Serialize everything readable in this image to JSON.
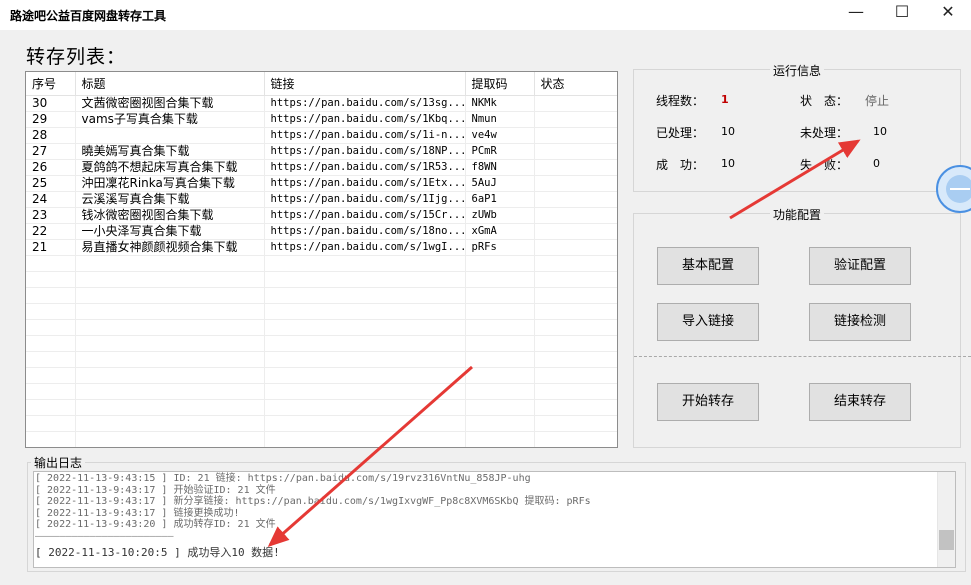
{
  "window": {
    "title": "路途吧公益百度网盘转存工具",
    "controls": {
      "minimize": "—",
      "maximize": "☐",
      "close": "✕"
    }
  },
  "list": {
    "title": "转存列表：",
    "columns": [
      "序号",
      "标题",
      "链接",
      "提取码",
      "状态"
    ],
    "rows": [
      {
        "id": "30",
        "title": "文茜微密圈视图合集下载",
        "link": "https://pan.baidu.com/s/13sg...",
        "code": "NKMk",
        "status": ""
      },
      {
        "id": "29",
        "title": "vams子写真合集下载",
        "link": "https://pan.baidu.com/s/1Kbq...",
        "code": "Nmun",
        "status": ""
      },
      {
        "id": "28",
        "title": "",
        "link": "https://pan.baidu.com/s/1i-n...",
        "code": "ve4w",
        "status": ""
      },
      {
        "id": "27",
        "title": "曉美嫣写真合集下载",
        "link": "https://pan.baidu.com/s/18NP...",
        "code": "PCmR",
        "status": ""
      },
      {
        "id": "26",
        "title": "夏鸽鸽不想起床写真合集下载",
        "link": "https://pan.baidu.com/s/1R53...",
        "code": "f8WN",
        "status": ""
      },
      {
        "id": "25",
        "title": "沖田凜花Rinka写真合集下载",
        "link": "https://pan.baidu.com/s/1Etx...",
        "code": "5AuJ",
        "status": ""
      },
      {
        "id": "24",
        "title": "云溪溪写真合集下载",
        "link": "https://pan.baidu.com/s/1Ijg...",
        "code": "6aP1",
        "status": ""
      },
      {
        "id": "23",
        "title": "钱冰微密圈视图合集下载",
        "link": "https://pan.baidu.com/s/15Cr...",
        "code": "zUWb",
        "status": ""
      },
      {
        "id": "22",
        "title": "一小央泽写真合集下载",
        "link": "https://pan.baidu.com/s/18no...",
        "code": "xGmA",
        "status": ""
      },
      {
        "id": "21",
        "title": "易直播女神颜颜视频合集下载",
        "link": "https://pan.baidu.com/s/1wgI...",
        "code": "pRFs",
        "status": ""
      }
    ]
  },
  "run_info": {
    "legend": "运行信息",
    "threads_label": "线程数：",
    "threads_value": "1",
    "state_label": "状　态：",
    "state_value": "停止",
    "processed_label": "已处理：",
    "processed_value": "10",
    "unprocessed_label": "未处理：",
    "unprocessed_value": "10",
    "success_label": "成　功：",
    "success_value": "10",
    "fail_label": "失　败：",
    "fail_value": "0"
  },
  "config": {
    "legend": "功能配置",
    "basic_config": "基本配置",
    "verify_config": "验证配置",
    "import_links": "导入链接",
    "check_links": "链接检测",
    "start_transfer": "开始转存",
    "end_transfer": "结束转存"
  },
  "log": {
    "legend": "输出日志",
    "lines": [
      "[ 2022-11-13-9:43:15 ] ID: 21 链接: https://pan.baidu.com/s/19rvz316VntNu_858JP-uhg",
      "[ 2022-11-13-9:43:17 ] 开始验证ID: 21 文件",
      "[ 2022-11-13-9:43:17 ] 新分享链接: https://pan.baidu.com/s/1wgIxvgWF_Pp8c8XVM6SKbQ 提取码: pRFs",
      "[ 2022-11-13-9:43:17 ] 链接更换成功!",
      "[ 2022-11-13-9:43:20 ] 成功转存ID: 21 文件"
    ],
    "separator": "———————————————————————",
    "final_line": "[ 2022-11-13-10:20:5 ] 成功导入10 数据!"
  },
  "colors": {
    "accent_red": "#e53935",
    "threads_red": "#c00000"
  }
}
